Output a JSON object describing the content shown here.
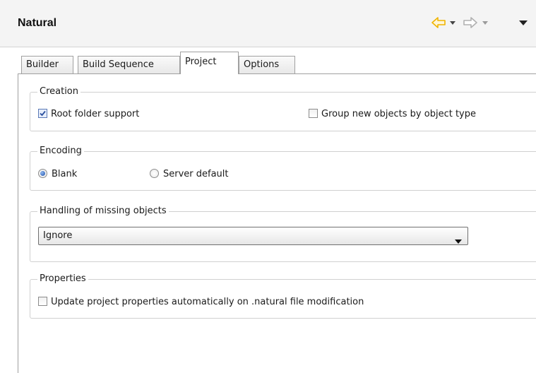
{
  "header": {
    "title": "Natural",
    "nav_icons": [
      "back-arrow-icon",
      "chevron-down-icon",
      "forward-arrow-icon",
      "chevron-down-icon",
      "view-menu-icon"
    ]
  },
  "tabs": [
    {
      "label": "Builder",
      "active": false
    },
    {
      "label": "Build Sequence",
      "active": false
    },
    {
      "label": "Project",
      "active": true
    },
    {
      "label": "Options",
      "active": false
    }
  ],
  "creation": {
    "legend": "Creation",
    "root_folder": {
      "label": "Root folder support",
      "checked": true
    },
    "group_by_type": {
      "label": "Group new objects by object type",
      "checked": false
    }
  },
  "encoding": {
    "legend": "Encoding",
    "blank": {
      "label": "Blank",
      "selected": true
    },
    "server_default": {
      "label": "Server default",
      "selected": false
    }
  },
  "missing": {
    "legend": "Handling of missing objects",
    "selected": "Ignore"
  },
  "properties": {
    "legend": "Properties",
    "auto_update": {
      "label": "Update project properties automatically on .natural file modification",
      "checked": false
    }
  },
  "colors": {
    "back_arrow": "#f0b400",
    "forward_arrow": "#b0b0b0",
    "header_bg": "#f4f4f4",
    "check_mark": "#2a4f9e"
  }
}
